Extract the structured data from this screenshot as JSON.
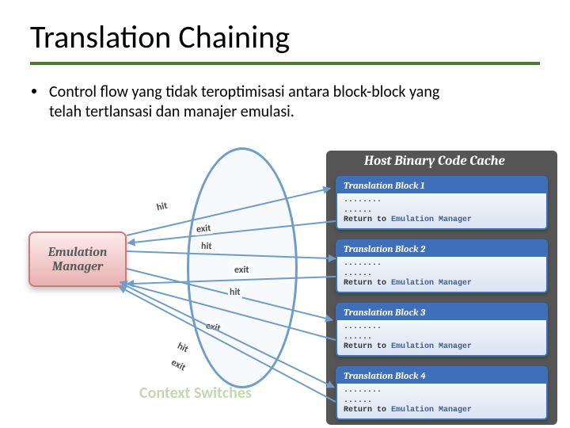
{
  "title": "Translation Chaining",
  "bullet": "Control flow yang tidak teroptimisasi antara block-block yang telah tertlansasi dan manajer emulasi.",
  "context_switches": "Context Switches",
  "em_box_l1": "Emulation",
  "em_box_l2": "Manager",
  "cache_title": "Host Binary Code Cache",
  "blocks": {
    "b1": {
      "hdr": "Translation Block 1",
      "body": "........\n......\nReturn to ",
      "ret": "Emulation Manager"
    },
    "b2": {
      "hdr": "Translation Block 2",
      "body": "........\n......\nReturn to ",
      "ret": "Emulation Manager"
    },
    "b3": {
      "hdr": "Translation Block 3",
      "body": "........\n......\nReturn to ",
      "ret": "Emulation Manager"
    },
    "b4": {
      "hdr": "Translation Block 4",
      "body": "........\n......\nReturn to ",
      "ret": "Emulation Manager"
    }
  },
  "labels": {
    "hit": "hit",
    "exit": "exit"
  }
}
